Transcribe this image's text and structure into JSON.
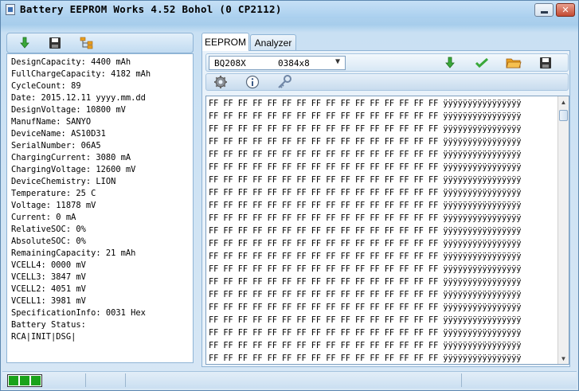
{
  "window": {
    "title": "Battery EEPROM Works  4.52 Bohol (0 CP2112)"
  },
  "left_panel": {
    "toolbar_icons": [
      "download-arrow-icon",
      "save-disk-icon",
      "tree-structure-icon"
    ],
    "info_lines": [
      "DesignCapacity: 4400 mAh",
      "FullChargeCapacity: 4182 mAh",
      "CycleCount: 89",
      "Date: 2015.12.11 yyyy.mm.dd",
      "DesignVoltage: 10800 mV",
      "ManufName: SANYO",
      "DeviceName: AS10D31",
      "SerialNumber: 06A5",
      "ChargingCurrent: 3080 mA",
      "ChargingVoltage: 12600 mV",
      "DeviceChemistry: LION",
      "Temperature: 25 C",
      "Voltage: 11878 mV",
      "Current: 0 mA",
      "RelativeSOC: 0%",
      "AbsoluteSOC: 0%",
      "RemainingCapacity: 21 mAh",
      "VCELL4: 0000 mV",
      "VCELL3: 3847 mV",
      "VCELL2: 4051 mV",
      "VCELL1: 3981 mV",
      "SpecificationInfo: 0031 Hex",
      "Battery Status:",
      "RCA|INIT|DSG|"
    ]
  },
  "tabs": [
    {
      "label": "EEPROM",
      "active": true
    },
    {
      "label": "Analyzer",
      "active": false
    }
  ],
  "chip_select": {
    "chip": "BQ208X",
    "size": "0384x8"
  },
  "toolbar_icons_right": [
    "download-arrow-icon",
    "checkmark-icon",
    "open-folder-icon",
    "save-disk-icon"
  ],
  "toolbar_icons_row2": [
    "gear-icon",
    "info-icon",
    "key-icon"
  ],
  "hex_rows": [
    "FF FF FF FF FF FF FF FF FF FF FF FF FF FF FF FF ÿÿÿÿÿÿÿÿÿÿÿÿÿÿÿÿ",
    "FF FF FF FF FF FF FF FF FF FF FF FF FF FF FF FF ÿÿÿÿÿÿÿÿÿÿÿÿÿÿÿÿ",
    "FF FF FF FF FF FF FF FF FF FF FF FF FF FF FF FF ÿÿÿÿÿÿÿÿÿÿÿÿÿÿÿÿ",
    "FF FF FF FF FF FF FF FF FF FF FF FF FF FF FF FF ÿÿÿÿÿÿÿÿÿÿÿÿÿÿÿÿ",
    "FF FF FF FF FF FF FF FF FF FF FF FF FF FF FF FF ÿÿÿÿÿÿÿÿÿÿÿÿÿÿÿÿ",
    "FF FF FF FF FF FF FF FF FF FF FF FF FF FF FF FF ÿÿÿÿÿÿÿÿÿÿÿÿÿÿÿÿ",
    "FF FF FF FF FF FF FF FF FF FF FF FF FF FF FF FF ÿÿÿÿÿÿÿÿÿÿÿÿÿÿÿÿ",
    "FF FF FF FF FF FF FF FF FF FF FF FF FF FF FF FF ÿÿÿÿÿÿÿÿÿÿÿÿÿÿÿÿ",
    "FF FF FF FF FF FF FF FF FF FF FF FF FF FF FF FF ÿÿÿÿÿÿÿÿÿÿÿÿÿÿÿÿ",
    "FF FF FF FF FF FF FF FF FF FF FF FF FF FF FF FF ÿÿÿÿÿÿÿÿÿÿÿÿÿÿÿÿ",
    "FF FF FF FF FF FF FF FF FF FF FF FF FF FF FF FF ÿÿÿÿÿÿÿÿÿÿÿÿÿÿÿÿ",
    "FF FF FF FF FF FF FF FF FF FF FF FF FF FF FF FF ÿÿÿÿÿÿÿÿÿÿÿÿÿÿÿÿ",
    "FF FF FF FF FF FF FF FF FF FF FF FF FF FF FF FF ÿÿÿÿÿÿÿÿÿÿÿÿÿÿÿÿ",
    "FF FF FF FF FF FF FF FF FF FF FF FF FF FF FF FF ÿÿÿÿÿÿÿÿÿÿÿÿÿÿÿÿ",
    "FF FF FF FF FF FF FF FF FF FF FF FF FF FF FF FF ÿÿÿÿÿÿÿÿÿÿÿÿÿÿÿÿ",
    "FF FF FF FF FF FF FF FF FF FF FF FF FF FF FF FF ÿÿÿÿÿÿÿÿÿÿÿÿÿÿÿÿ",
    "FF FF FF FF FF FF FF FF FF FF FF FF FF FF FF FF ÿÿÿÿÿÿÿÿÿÿÿÿÿÿÿÿ",
    "FF FF FF FF FF FF FF FF FF FF FF FF FF FF FF FF ÿÿÿÿÿÿÿÿÿÿÿÿÿÿÿÿ",
    "FF FF FF FF FF FF FF FF FF FF FF FF FF FF FF FF ÿÿÿÿÿÿÿÿÿÿÿÿÿÿÿÿ",
    "FF FF FF FF FF FF FF FF FF FF FF FF FF FF FF FF ÿÿÿÿÿÿÿÿÿÿÿÿÿÿÿÿ",
    "FF FF FF FF FF FF FF FF FF FF FF FF FF FF FF FF ÿÿÿÿÿÿÿÿÿÿÿÿÿÿÿÿ"
  ],
  "colors": {
    "led_green": "#1aa31a",
    "icon_green": "#3aa83a",
    "folder_orange": "#e8a020"
  }
}
